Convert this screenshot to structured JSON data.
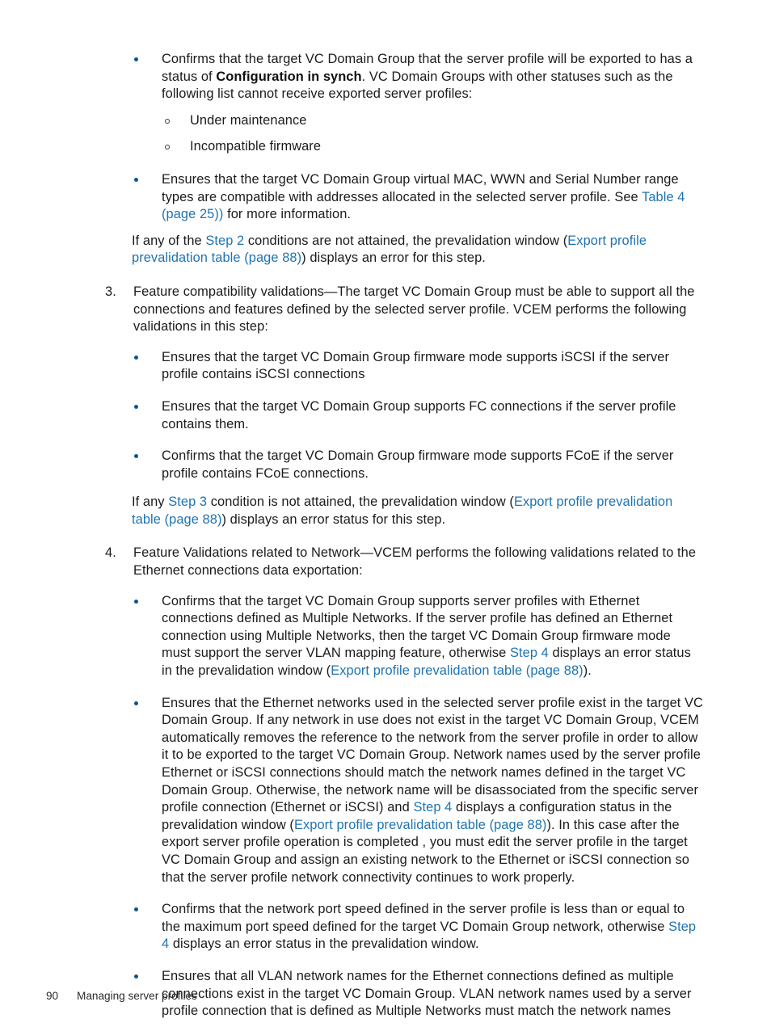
{
  "document": {
    "footer": {
      "page_number": "90",
      "title": "Managing server profiles"
    },
    "link_color": "#1f73b0",
    "bullet_color": "#10538c"
  },
  "blocks": {
    "b1": {
      "bullet_1": {
        "part1": "Confirms that the target VC Domain Group that the server profile will be exported to has a status of ",
        "bold": "Configuration in synch",
        "part2": ". VC Domain Groups with other statuses such as the following list cannot receive exported server profiles:"
      },
      "sub_1": "Under maintenance",
      "sub_2": "Incompatible firmware",
      "bullet_2": {
        "part1": "Ensures that the target VC Domain Group virtual MAC, WWN and Serial Number range types are compatible with addresses allocated in the selected server profile. See ",
        "link1": "Table 4 (page 25))",
        "part2": " for more information."
      },
      "closing": {
        "part1": "If any of the ",
        "link1": "Step 2",
        "part2": " conditions are not attained, the prevalidation window (",
        "link2": "Export profile prevalidation table (page 88)",
        "part3": ") displays an error for this step."
      }
    },
    "item3": {
      "marker": "3.",
      "intro": "Feature compatibility validations—The target VC Domain Group must be able to support all the connections and features defined by the selected server profile. VCEM performs the following validations in this step:",
      "bullet_1": "Ensures that the target VC Domain Group firmware mode supports iSCSI if the server profile contains iSCSI connections",
      "bullet_2": "Ensures that the target VC Domain Group supports FC connections if the server profile contains them.",
      "bullet_3": "Confirms that the target VC Domain Group firmware mode supports FCoE if the server profile contains FCoE connections.",
      "closing": {
        "part1": "If any ",
        "link1": "Step 3",
        "part2": " condition is not attained, the prevalidation window (",
        "link2": "Export profile prevalidation table (page 88)",
        "part3": ") displays an error status for this step."
      }
    },
    "item4": {
      "marker": "4.",
      "intro": "Feature Validations related to Network—VCEM performs the following validations related to the Ethernet connections data exportation:",
      "bullet_1": {
        "part1": "Confirms that the target VC Domain Group supports server profiles with Ethernet connections defined as Multiple Networks. If the server profile has defined an Ethernet connection using Multiple Networks, then the target VC Domain Group firmware mode must support the server VLAN mapping feature, otherwise ",
        "link1": "Step 4",
        "part2": " displays an error status in the prevalidation window (",
        "link2": "Export profile prevalidation table (page 88)",
        "part3": ")."
      },
      "bullet_2": {
        "part1": "Ensures that the Ethernet networks used in the selected server profile exist in the target VC Domain Group. If any network in use does not exist in the target VC Domain Group, VCEM automatically removes the reference to the network from the server profile in order to allow it to be exported to the target VC Domain Group. Network names used by the server profile Ethernet or iSCSI connections should match the network names defined in the target VC Domain Group. Otherwise, the network name will be disassociated from the specific server profile connection (Ethernet or iSCSI) and ",
        "link1": "Step 4",
        "part2": " displays a configuration status in the prevalidation window (",
        "link2": "Export profile prevalidation table (page 88)",
        "part3": "). In this case after the export server profile operation is completed , you must edit the server profile in the target VC Domain Group and assign an existing network to the Ethernet or iSCSI connection so that the server profile network connectivity continues to work properly."
      },
      "bullet_3": {
        "part1": "Confirms that the network port speed defined in the server profile is less than or equal to the maximum port speed defined for the target VC Domain Group network, otherwise ",
        "link1": "Step 4",
        "part2": " displays an error status in the prevalidation window."
      },
      "bullet_4": "Ensures that all VLAN network names for the Ethernet connections defined as multiple connections exist in the target VC Domain Group. VLAN network names used by a server profile connection that is defined as Multiple Networks must match the network names"
    }
  }
}
